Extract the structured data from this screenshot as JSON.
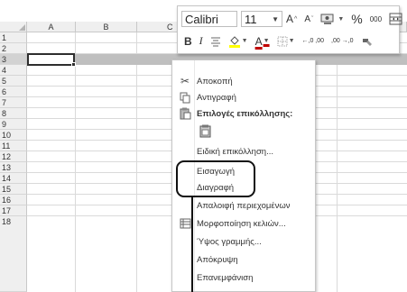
{
  "columns": [
    "A",
    "B",
    "C"
  ],
  "rows": [
    "1",
    "2",
    "3",
    "4",
    "5",
    "6",
    "7",
    "8",
    "9",
    "10",
    "11",
    "12",
    "13",
    "14",
    "15",
    "16",
    "17",
    "18"
  ],
  "selected_row": "3",
  "mini_toolbar": {
    "font_name": "Calibri",
    "font_size": "11",
    "increase_font_label": "A",
    "decrease_font_label": "A",
    "percent_label": "%",
    "thousands_label": "000",
    "bold_label": "B",
    "italic_label": "I",
    "font_color_label": "A",
    "increase_decimal_label": "←,0 ,00",
    "decrease_decimal_label": ",00 →,0"
  },
  "context_menu": {
    "items": [
      {
        "label": "Αποκοπή",
        "icon": "scissors-icon"
      },
      {
        "label": "Αντιγραφή",
        "icon": "copy-icon"
      },
      {
        "label": "Επιλογές επικόλλησης:",
        "icon": "paste-icon"
      },
      {
        "label": "",
        "icon": "paste-option-icon"
      },
      {
        "label": "Ειδική επικόλληση...",
        "icon": ""
      },
      {
        "label": "Εισαγωγή",
        "icon": ""
      },
      {
        "label": "Διαγραφή",
        "icon": ""
      },
      {
        "label": "Απαλοιφή περιεχομένων",
        "icon": ""
      },
      {
        "label": "Μορφοποίηση κελιών...",
        "icon": "format-cells-icon"
      },
      {
        "label": "Ύψος γραμμής...",
        "icon": ""
      },
      {
        "label": "Απόκρυψη",
        "icon": ""
      },
      {
        "label": "Επανεμφάνιση",
        "icon": ""
      }
    ]
  }
}
